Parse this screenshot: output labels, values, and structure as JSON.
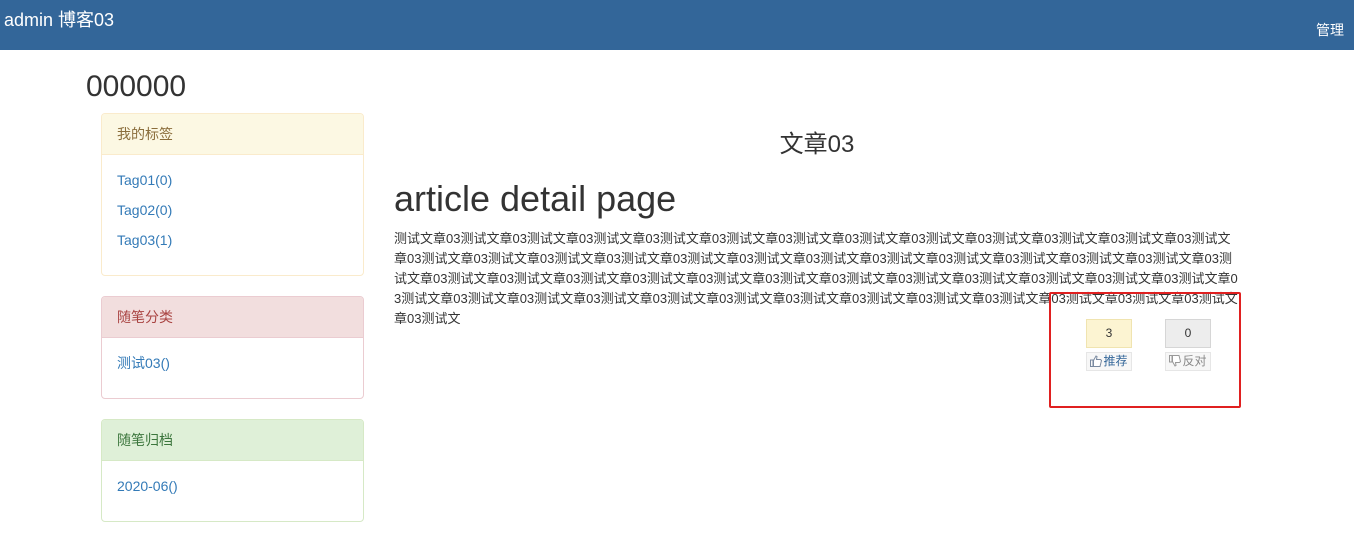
{
  "navbar": {
    "brand": "admin 博客03",
    "manage_label": "管理",
    "background": "#336699"
  },
  "site_title": "000000",
  "sidebar": {
    "tags": {
      "heading": "我的标签",
      "items": [
        "Tag01(0)",
        "Tag02(0)",
        "Tag03(1)"
      ]
    },
    "categories": {
      "heading": "随笔分类",
      "items": [
        "测试03()"
      ]
    },
    "archive": {
      "heading": "随笔归档",
      "items": [
        "2020-06()"
      ]
    }
  },
  "article": {
    "title": "文章03",
    "heading": "article detail page",
    "body": "测试文章03测试文章03测试文章03测试文章03测试文章03测试文章03测试文章03测试文章03测试文章03测试文章03测试文章03测试文章03测试文章03测试文章03测试文章03测试文章03测试文章03测试文章03测试文章03测试文章03测试文章03测试文章03测试文章03测试文章03测试文章03测试文章03测试文章03测试文章03测试文章03测试文章03测试文章03测试文章03测试文章03测试文章03测试文章03测试文章03测试文章03测试文章03测试文章03测试文章03测试文章03测试文章03测试文章03测试文章03测试文章03测试文章03测试文章03测试文章03测试文章03测试文章03测试文章03测试文"
  },
  "votes": {
    "digg_count": "3",
    "digg_label": "推荐",
    "digg_icon": "thumbs-up-icon",
    "bury_count": "0",
    "bury_label": "反对",
    "bury_icon": "thumbs-down-icon"
  },
  "colors": {
    "highlight_border": "#e02020",
    "link": "#337ab7"
  }
}
